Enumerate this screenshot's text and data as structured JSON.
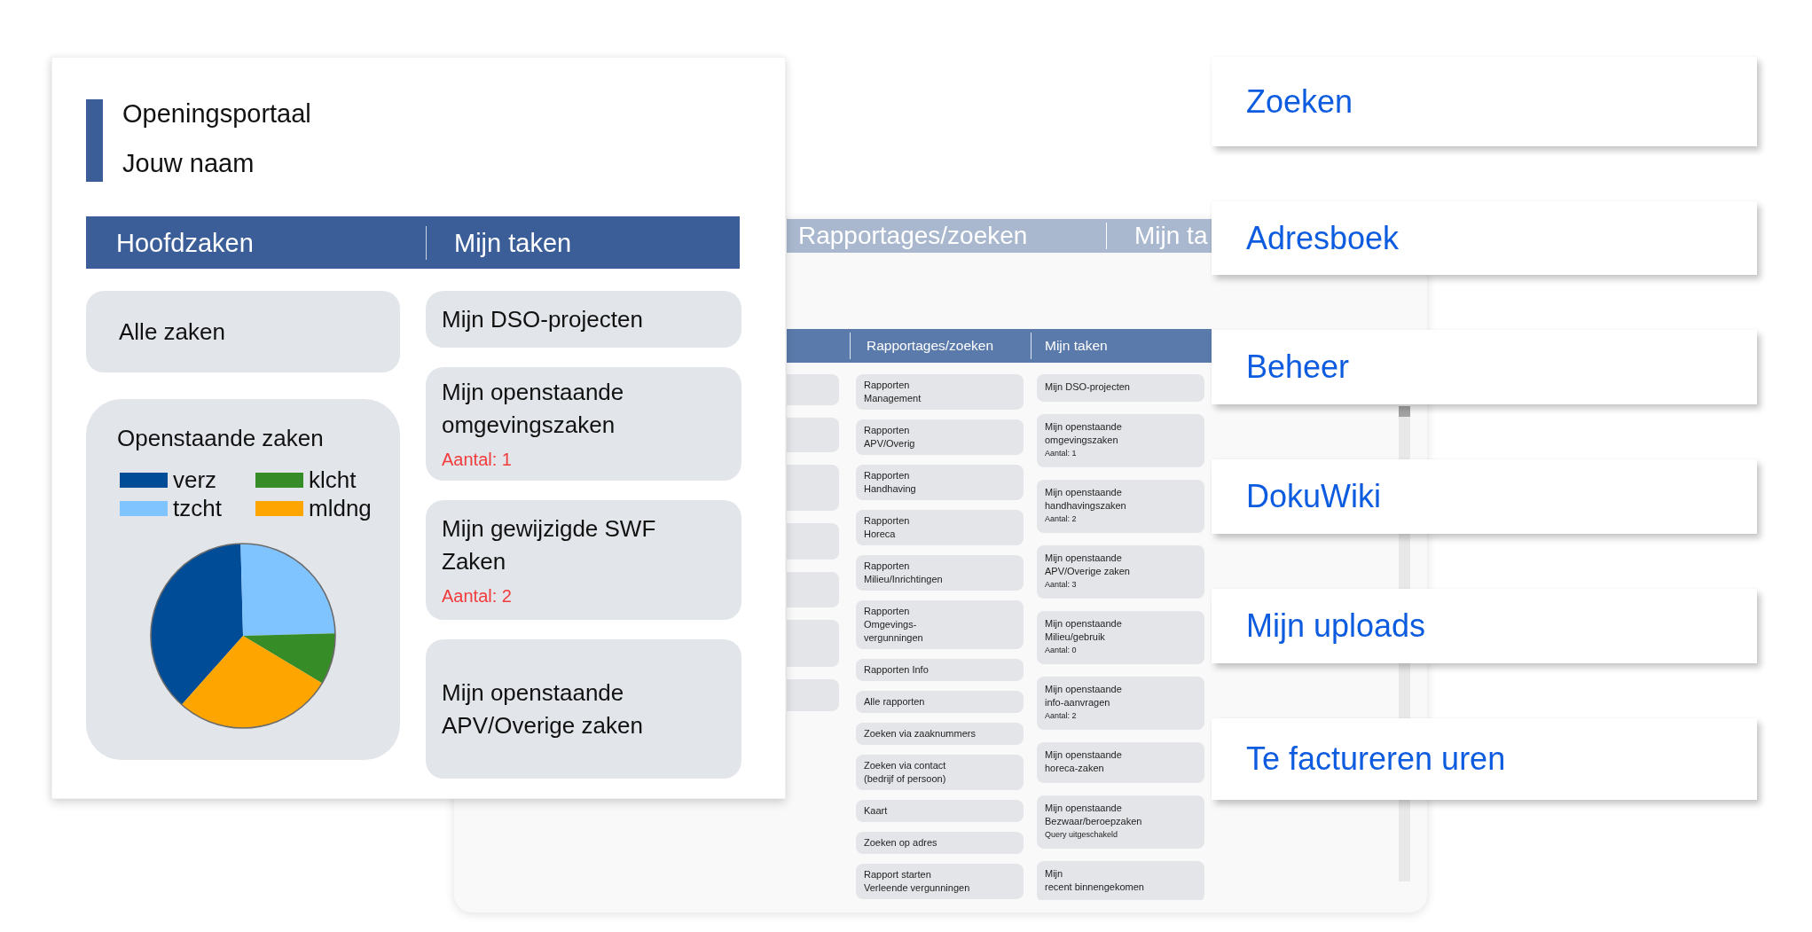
{
  "portal": {
    "title": "Openingsportaal",
    "user_name": "Jouw naam",
    "columns": [
      {
        "heading": "Hoofdzaken",
        "tiles": [
          {
            "kind": "link",
            "label": "Alle zaken"
          },
          {
            "kind": "chart",
            "chart_data": {
              "type": "pie",
              "title": "Openstaande zaken",
              "legend": "top",
              "categories": [
                "verz",
                "tzcht",
                "klcht",
                "mldng"
              ],
              "values": [
                38,
                25,
                9,
                28
              ],
              "colors": [
                "#004c97",
                "#80c4ff",
                "#368c27",
                "#ffa500"
              ]
            }
          }
        ]
      },
      {
        "heading": "Mijn taken",
        "tiles": [
          {
            "kind": "link",
            "label": "Mijn DSO-projecten"
          },
          {
            "kind": "link",
            "label": "Mijn openstaande omgevingszaken",
            "status": "Aantal: 1"
          },
          {
            "kind": "link",
            "label": "Mijn gewijzigde SWF Zaken",
            "status": "Aantal: 2"
          },
          {
            "kind": "link",
            "label": "Mijn openstaande APV/Overige zaken"
          }
        ]
      }
    ]
  },
  "background_window": {
    "title_strip": [
      "Rapportages/zoeken",
      "Mijn ta"
    ],
    "columns": [
      {
        "heading": "Rapportages/zoeken",
        "tiles": [
          {
            "lines": [
              "Rapporten",
              "Management"
            ]
          },
          {
            "lines": [
              "Rapporten",
              "APV/Overig"
            ]
          },
          {
            "lines": [
              "Rapporten",
              "Handhaving"
            ]
          },
          {
            "lines": [
              "Rapporten",
              "Horeca"
            ]
          },
          {
            "lines": [
              "Rapporten",
              "Milieu/Inrichtingen"
            ]
          },
          {
            "lines": [
              "Rapporten",
              "Omgevings-",
              "vergunningen"
            ]
          },
          {
            "lines": [
              "Rapporten Info"
            ]
          },
          {
            "lines": [
              "Alle rapporten"
            ]
          },
          {
            "lines": [
              "Zoeken via zaaknummers"
            ]
          },
          {
            "lines": [
              "Zoeken via contact",
              "(bedrijf of persoon)"
            ]
          },
          {
            "lines": [
              "Kaart"
            ]
          },
          {
            "lines": [
              "Zoeken op adres"
            ]
          },
          {
            "lines": [
              "Rapport starten",
              "Verleende vergunningen"
            ]
          }
        ]
      },
      {
        "heading": "Mijn taken",
        "tiles": [
          {
            "lines": [
              "Mijn DSO-projecten"
            ]
          },
          {
            "lines": [
              "Mijn openstaande",
              "omgevingszaken"
            ],
            "status": "Aantal: 1"
          },
          {
            "lines": [
              "Mijn openstaande",
              "handhavingszaken"
            ],
            "status": "Aantal: 2"
          },
          {
            "lines": [
              "Mijn openstaande",
              "APV/Overige zaken"
            ],
            "status": "Aantal: 3"
          },
          {
            "lines": [
              "Mijn openstaande",
              "Milieu/gebruik"
            ],
            "status": "Aantal: 0"
          },
          {
            "lines": [
              "Mijn openstaande",
              "info-aanvragen"
            ],
            "status": "Aantal: 2"
          },
          {
            "lines": [
              "Mijn openstaande",
              "horeca-zaken"
            ]
          },
          {
            "lines": [
              "Mijn openstaande",
              "Bezwaar/beroepzaken"
            ],
            "status": "Query uitgeschakeld"
          },
          {
            "lines": [
              "Mijn",
              "recent binnengekomen"
            ]
          }
        ]
      }
    ]
  },
  "quick_links": [
    {
      "label": "Zoeken"
    },
    {
      "label": "Adresboek"
    },
    {
      "label": "Beheer"
    },
    {
      "label": "DokuWiki"
    },
    {
      "label": "Mijn uploads"
    },
    {
      "label": "Te factureren uren"
    }
  ]
}
